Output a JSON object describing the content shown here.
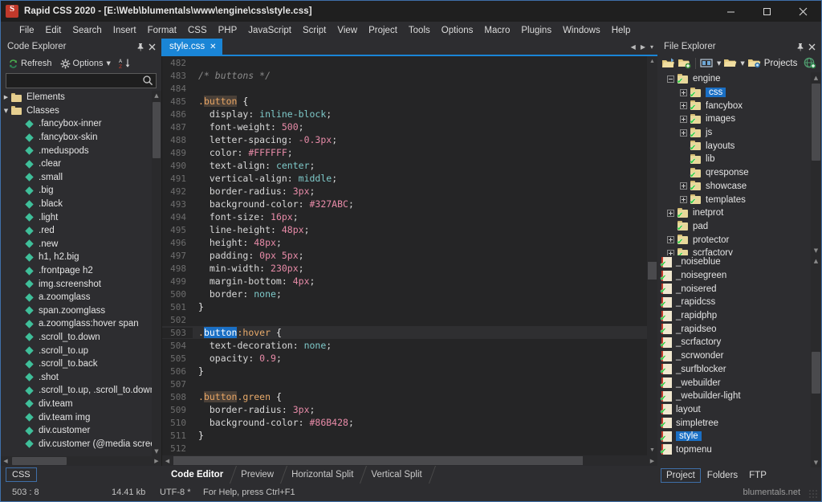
{
  "window": {
    "title": "Rapid CSS 2020 - [E:\\Web\\blumentals\\www\\engine\\css\\style.css]",
    "logo_text": "S",
    "minimize": "–",
    "maximize": "☐",
    "close": "✕"
  },
  "menubar": {
    "items": [
      {
        "label": "File"
      },
      {
        "label": "Edit"
      },
      {
        "label": "Search"
      },
      {
        "label": "Insert"
      },
      {
        "label": "Format"
      },
      {
        "label": "CSS"
      },
      {
        "label": "PHP"
      },
      {
        "label": "JavaScript"
      },
      {
        "label": "Script"
      },
      {
        "label": "View"
      },
      {
        "label": "Project"
      },
      {
        "label": "Tools"
      },
      {
        "label": "Options"
      },
      {
        "label": "Macro"
      },
      {
        "label": "Plugins"
      },
      {
        "label": "Windows"
      },
      {
        "label": "Help"
      }
    ]
  },
  "code_explorer": {
    "title": "Code Explorer",
    "pin": "📌",
    "close": "✕",
    "toolbar": {
      "refresh": "Refresh",
      "options": "Options",
      "sort_label": "AZ"
    },
    "search": {
      "value": "",
      "placeholder": ""
    },
    "tree": [
      {
        "label": "Elements",
        "type": "folder",
        "expanded": false,
        "indent": 0
      },
      {
        "label": "Classes",
        "type": "folder",
        "expanded": true,
        "indent": 0
      },
      {
        "label": ".fancybox-inner",
        "type": "class",
        "indent": 1
      },
      {
        "label": ".fancybox-skin",
        "type": "class",
        "indent": 1
      },
      {
        "label": ".meduspods",
        "type": "class",
        "indent": 1
      },
      {
        "label": ".clear",
        "type": "class",
        "indent": 1
      },
      {
        "label": ".small",
        "type": "class",
        "indent": 1
      },
      {
        "label": ".big",
        "type": "class",
        "indent": 1
      },
      {
        "label": ".black",
        "type": "class",
        "indent": 1
      },
      {
        "label": ".light",
        "type": "class",
        "indent": 1
      },
      {
        "label": ".red",
        "type": "class",
        "indent": 1
      },
      {
        "label": ".new",
        "type": "class",
        "indent": 1
      },
      {
        "label": "h1, h2.big",
        "type": "class",
        "indent": 1
      },
      {
        "label": ".frontpage h2",
        "type": "class",
        "indent": 1
      },
      {
        "label": "img.screenshot",
        "type": "class",
        "indent": 1
      },
      {
        "label": "a.zoomglass",
        "type": "class",
        "indent": 1
      },
      {
        "label": "span.zoomglass",
        "type": "class",
        "indent": 1
      },
      {
        "label": "a.zoomglass:hover span",
        "type": "class",
        "indent": 1
      },
      {
        "label": ".scroll_to.down",
        "type": "class",
        "indent": 1
      },
      {
        "label": ".scroll_to.up",
        "type": "class",
        "indent": 1
      },
      {
        "label": ".scroll_to.back",
        "type": "class",
        "indent": 1
      },
      {
        "label": ".shot",
        "type": "class",
        "indent": 1
      },
      {
        "label": ".scroll_to.up, .scroll_to.down,",
        "type": "class",
        "indent": 1
      },
      {
        "label": "div.team",
        "type": "class",
        "indent": 1
      },
      {
        "label": "div.team img",
        "type": "class",
        "indent": 1
      },
      {
        "label": "div.customer",
        "type": "class",
        "indent": 1
      },
      {
        "label": "div.customer (@media screen",
        "type": "class",
        "indent": 1
      }
    ],
    "language_badge": "CSS"
  },
  "editor": {
    "tab": {
      "label": "style.css",
      "close": "✕"
    },
    "nav": {
      "prev": "◀",
      "next": "▶",
      "menu": "▾"
    },
    "lines": [
      {
        "n": "482",
        "tokens": [],
        "current": false
      },
      {
        "n": "483",
        "tokens": [
          {
            "t": "/* buttons */",
            "c": "tk-comment"
          }
        ],
        "current": false
      },
      {
        "n": "484",
        "tokens": [],
        "current": false
      },
      {
        "n": "485",
        "tokens": [
          {
            "t": ".",
            "c": "tk-sel"
          },
          {
            "t": "button",
            "c": "tk-selhl"
          },
          {
            "t": " {",
            "c": "tk-brace"
          }
        ],
        "current": false
      },
      {
        "n": "486",
        "tokens": [
          {
            "t": "  display",
            "c": "tk-prop"
          },
          {
            "t": ": ",
            "c": "tk-punc"
          },
          {
            "t": "inline-block",
            "c": "tk-val"
          },
          {
            "t": ";",
            "c": "tk-punc"
          }
        ],
        "current": false
      },
      {
        "n": "487",
        "tokens": [
          {
            "t": "  font-weight",
            "c": "tk-prop"
          },
          {
            "t": ": ",
            "c": "tk-punc"
          },
          {
            "t": "500",
            "c": "tk-num"
          },
          {
            "t": ";",
            "c": "tk-punc"
          }
        ],
        "current": false
      },
      {
        "n": "488",
        "tokens": [
          {
            "t": "  letter-spacing",
            "c": "tk-prop"
          },
          {
            "t": ": ",
            "c": "tk-punc"
          },
          {
            "t": "-0.3px",
            "c": "tk-num"
          },
          {
            "t": ";",
            "c": "tk-punc"
          }
        ],
        "current": false
      },
      {
        "n": "489",
        "tokens": [
          {
            "t": "  color",
            "c": "tk-prop"
          },
          {
            "t": ": ",
            "c": "tk-punc"
          },
          {
            "t": "#FFFFFF",
            "c": "tk-hex"
          },
          {
            "t": ";",
            "c": "tk-punc"
          }
        ],
        "current": false
      },
      {
        "n": "490",
        "tokens": [
          {
            "t": "  text-align",
            "c": "tk-prop"
          },
          {
            "t": ": ",
            "c": "tk-punc"
          },
          {
            "t": "center",
            "c": "tk-val"
          },
          {
            "t": ";",
            "c": "tk-punc"
          }
        ],
        "current": false
      },
      {
        "n": "491",
        "tokens": [
          {
            "t": "  vertical-align",
            "c": "tk-prop"
          },
          {
            "t": ": ",
            "c": "tk-punc"
          },
          {
            "t": "middle",
            "c": "tk-val"
          },
          {
            "t": ";",
            "c": "tk-punc"
          }
        ],
        "current": false
      },
      {
        "n": "492",
        "tokens": [
          {
            "t": "  border-radius",
            "c": "tk-prop"
          },
          {
            "t": ": ",
            "c": "tk-punc"
          },
          {
            "t": "3px",
            "c": "tk-num"
          },
          {
            "t": ";",
            "c": "tk-punc"
          }
        ],
        "current": false
      },
      {
        "n": "493",
        "tokens": [
          {
            "t": "  background-color",
            "c": "tk-prop"
          },
          {
            "t": ": ",
            "c": "tk-punc"
          },
          {
            "t": "#327ABC",
            "c": "tk-hex"
          },
          {
            "t": ";",
            "c": "tk-punc"
          }
        ],
        "current": false
      },
      {
        "n": "494",
        "tokens": [
          {
            "t": "  font-size",
            "c": "tk-prop"
          },
          {
            "t": ": ",
            "c": "tk-punc"
          },
          {
            "t": "16px",
            "c": "tk-num"
          },
          {
            "t": ";",
            "c": "tk-punc"
          }
        ],
        "current": false
      },
      {
        "n": "495",
        "tokens": [
          {
            "t": "  line-height",
            "c": "tk-prop"
          },
          {
            "t": ": ",
            "c": "tk-punc"
          },
          {
            "t": "48px",
            "c": "tk-num"
          },
          {
            "t": ";",
            "c": "tk-punc"
          }
        ],
        "current": false
      },
      {
        "n": "496",
        "tokens": [
          {
            "t": "  height",
            "c": "tk-prop"
          },
          {
            "t": ": ",
            "c": "tk-punc"
          },
          {
            "t": "48px",
            "c": "tk-num"
          },
          {
            "t": ";",
            "c": "tk-punc"
          }
        ],
        "current": false
      },
      {
        "n": "497",
        "tokens": [
          {
            "t": "  padding",
            "c": "tk-prop"
          },
          {
            "t": ": ",
            "c": "tk-punc"
          },
          {
            "t": "0px 5px",
            "c": "tk-num"
          },
          {
            "t": ";",
            "c": "tk-punc"
          }
        ],
        "current": false
      },
      {
        "n": "498",
        "tokens": [
          {
            "t": "  min-width",
            "c": "tk-prop"
          },
          {
            "t": ": ",
            "c": "tk-punc"
          },
          {
            "t": "230px",
            "c": "tk-num"
          },
          {
            "t": ";",
            "c": "tk-punc"
          }
        ],
        "current": false
      },
      {
        "n": "499",
        "tokens": [
          {
            "t": "  margin-bottom",
            "c": "tk-prop"
          },
          {
            "t": ": ",
            "c": "tk-punc"
          },
          {
            "t": "4px",
            "c": "tk-num"
          },
          {
            "t": ";",
            "c": "tk-punc"
          }
        ],
        "current": false
      },
      {
        "n": "500",
        "tokens": [
          {
            "t": "  border",
            "c": "tk-prop"
          },
          {
            "t": ": ",
            "c": "tk-punc"
          },
          {
            "t": "none",
            "c": "tk-val"
          },
          {
            "t": ";",
            "c": "tk-punc"
          }
        ],
        "current": false
      },
      {
        "n": "501",
        "tokens": [
          {
            "t": "}",
            "c": "tk-brace"
          }
        ],
        "current": false
      },
      {
        "n": "502",
        "tokens": [],
        "current": false
      },
      {
        "n": "503",
        "tokens": [
          {
            "t": ".",
            "c": "tk-sel"
          },
          {
            "t": "button",
            "c": "tk-selblue"
          },
          {
            "t": ":hover",
            "c": "tk-sel"
          },
          {
            "t": " {",
            "c": "tk-brace"
          }
        ],
        "current": true
      },
      {
        "n": "504",
        "tokens": [
          {
            "t": "  text-decoration",
            "c": "tk-prop"
          },
          {
            "t": ": ",
            "c": "tk-punc"
          },
          {
            "t": "none",
            "c": "tk-val"
          },
          {
            "t": ";",
            "c": "tk-punc"
          }
        ],
        "current": false
      },
      {
        "n": "505",
        "tokens": [
          {
            "t": "  opacity",
            "c": "tk-prop"
          },
          {
            "t": ": ",
            "c": "tk-punc"
          },
          {
            "t": "0.9",
            "c": "tk-num"
          },
          {
            "t": ";",
            "c": "tk-punc"
          }
        ],
        "current": false
      },
      {
        "n": "506",
        "tokens": [
          {
            "t": "}",
            "c": "tk-brace"
          }
        ],
        "current": false
      },
      {
        "n": "507",
        "tokens": [],
        "current": false
      },
      {
        "n": "508",
        "tokens": [
          {
            "t": ".",
            "c": "tk-sel"
          },
          {
            "t": "button",
            "c": "tk-selhl"
          },
          {
            "t": ".green",
            "c": "tk-sel"
          },
          {
            "t": " {",
            "c": "tk-brace"
          }
        ],
        "current": false
      },
      {
        "n": "509",
        "tokens": [
          {
            "t": "  border-radius",
            "c": "tk-prop"
          },
          {
            "t": ": ",
            "c": "tk-punc"
          },
          {
            "t": "3px",
            "c": "tk-num"
          },
          {
            "t": ";",
            "c": "tk-punc"
          }
        ],
        "current": false
      },
      {
        "n": "510",
        "tokens": [
          {
            "t": "  background-color",
            "c": "tk-prop"
          },
          {
            "t": ": ",
            "c": "tk-punc"
          },
          {
            "t": "#86B428",
            "c": "tk-hex"
          },
          {
            "t": ";",
            "c": "tk-punc"
          }
        ],
        "current": false
      },
      {
        "n": "511",
        "tokens": [
          {
            "t": "}",
            "c": "tk-brace"
          }
        ],
        "current": false
      },
      {
        "n": "512",
        "tokens": [],
        "current": false
      }
    ],
    "view_tabs": [
      {
        "label": "Code Editor",
        "active": true
      },
      {
        "label": "Preview",
        "active": false
      },
      {
        "label": "Horizontal Split",
        "active": false
      },
      {
        "label": "Vertical Split",
        "active": false
      }
    ]
  },
  "file_explorer": {
    "title": "File Explorer",
    "pin": "📌",
    "close": "✕",
    "toolbar": {
      "projects_label": "Projects"
    },
    "tree": [
      {
        "label": "engine",
        "type": "folder",
        "indent": 0,
        "expander": "minus"
      },
      {
        "label": "css",
        "type": "folder",
        "indent": 1,
        "expander": "plus",
        "selected": true
      },
      {
        "label": "fancybox",
        "type": "folder",
        "indent": 1,
        "expander": "plus"
      },
      {
        "label": "images",
        "type": "folder",
        "indent": 1,
        "expander": "plus"
      },
      {
        "label": "js",
        "type": "folder",
        "indent": 1,
        "expander": "plus"
      },
      {
        "label": "layouts",
        "type": "folder",
        "indent": 1,
        "expander": "none"
      },
      {
        "label": "lib",
        "type": "folder",
        "indent": 1,
        "expander": "none"
      },
      {
        "label": "qresponse",
        "type": "folder",
        "indent": 1,
        "expander": "none"
      },
      {
        "label": "showcase",
        "type": "folder",
        "indent": 1,
        "expander": "plus"
      },
      {
        "label": "templates",
        "type": "folder",
        "indent": 1,
        "expander": "plus"
      },
      {
        "label": "inetprot",
        "type": "folder",
        "indent": 0,
        "expander": "plus"
      },
      {
        "label": "pad",
        "type": "folder",
        "indent": 0,
        "expander": "none"
      },
      {
        "label": "protector",
        "type": "folder",
        "indent": 0,
        "expander": "plus"
      },
      {
        "label": "scrfactory",
        "type": "folder",
        "indent": 0,
        "expander": "plus"
      }
    ],
    "files": [
      {
        "label": "_noiseblue",
        "selected": false
      },
      {
        "label": "_noisegreen",
        "selected": false
      },
      {
        "label": "_noisered",
        "selected": false
      },
      {
        "label": "_rapidcss",
        "selected": false
      },
      {
        "label": "_rapidphp",
        "selected": false
      },
      {
        "label": "_rapidseo",
        "selected": false
      },
      {
        "label": "_scrfactory",
        "selected": false
      },
      {
        "label": "_scrwonder",
        "selected": false
      },
      {
        "label": "_surfblocker",
        "selected": false
      },
      {
        "label": "_webuilder",
        "selected": false
      },
      {
        "label": "_webuilder-light",
        "selected": false
      },
      {
        "label": "layout",
        "selected": false
      },
      {
        "label": "simpletree",
        "selected": false
      },
      {
        "label": "style",
        "selected": true
      },
      {
        "label": "topmenu",
        "selected": false
      }
    ],
    "bottom_tabs": [
      {
        "label": "Project",
        "active": true
      },
      {
        "label": "Folders",
        "active": false
      },
      {
        "label": "FTP",
        "active": false
      }
    ]
  },
  "statusbar": {
    "position": "503 : 8",
    "filesize": "14.41 kb",
    "encoding": "UTF-8 *",
    "help": "For Help, press Ctrl+F1",
    "brand": "blumentals.net"
  },
  "colors": {
    "accent": "#1a85d6",
    "selection": "#1a6fc4",
    "panel_bg": "#2d2d30",
    "editor_bg": "#252526",
    "class_icon": "#3fbf9a",
    "folder_icon": "#e6cf90",
    "check_green": "#2ecc40"
  }
}
